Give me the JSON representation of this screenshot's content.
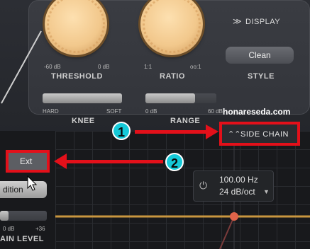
{
  "header": {
    "display_label": "DISPLAY",
    "display_icon": "double-chevron-down-icon"
  },
  "threshold": {
    "scale_min": "-60 dB",
    "scale_max": "0 dB",
    "label": "THRESHOLD"
  },
  "ratio": {
    "scale_min": "1:1",
    "scale_max": "oo:1",
    "label": "RATIO"
  },
  "style": {
    "button_label": "Clean",
    "label": "STYLE"
  },
  "knee": {
    "scale_min": "HARD",
    "scale_max": "SOFT",
    "label": "KNEE"
  },
  "range": {
    "scale_min": "0 dB",
    "scale_max": "60 dB",
    "label": "RANGE"
  },
  "sidechain": {
    "label": "SIDE CHAIN",
    "icon": "double-chevron-up-icon"
  },
  "ext_button": {
    "label": "Ext"
  },
  "audition_button": {
    "label": "dition"
  },
  "filter": {
    "freq": "100.00 Hz",
    "slope": "24 dB/oct",
    "power_icon": "power-icon",
    "dropdown_icon": "triangle-down-icon"
  },
  "gain": {
    "scale_min": "0 dB",
    "scale_max": "+36",
    "label": "AIN LEVEL"
  },
  "watermark": "honareseda.com",
  "annotations": {
    "marker1": "1",
    "marker2": "2",
    "color": "#e3101a",
    "marker_color": "#15c9d8"
  },
  "colors": {
    "knob": "#f2c88c",
    "curve": "#c9963f",
    "curve_point": "#e0644a"
  }
}
